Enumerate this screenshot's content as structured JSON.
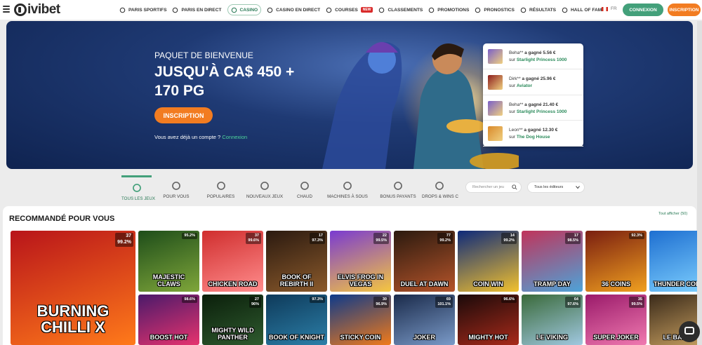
{
  "header": {
    "logo_text": "ivibet",
    "nav": [
      {
        "label": "PARIS SPORTIFS",
        "icon": "soccer-ball-icon"
      },
      {
        "label": "PARIS EN DIRECT",
        "icon": "live-icon"
      },
      {
        "label": "CASINO",
        "icon": "casino-chip-icon",
        "active": true
      },
      {
        "label": "CASINO EN DIRECT",
        "icon": "live-casino-icon"
      },
      {
        "label": "COURSES",
        "icon": "horse-icon",
        "badge": "NEW"
      },
      {
        "label": "CLASSEMENTS",
        "icon": "ranking-icon"
      },
      {
        "label": "PROMOTIONS",
        "icon": "gift-icon"
      },
      {
        "label": "PRONOSTICS",
        "icon": "prediction-icon"
      },
      {
        "label": "RÉSULTATS",
        "icon": "results-icon"
      },
      {
        "label": "HALL OF FAME",
        "icon": "crown-icon"
      }
    ],
    "lang": "FR",
    "login_label": "CONNEXION",
    "signup_label": "INSCRIPTION"
  },
  "hero": {
    "subtitle": "PAQUET DE BIENVENUE",
    "title": "JUSQU'À CA$ 450 + 170 PG",
    "cta": "INSCRIPTION",
    "login_prompt": "Vous avez déjà un compte ?",
    "login_link": "Connexion"
  },
  "winners": [
    {
      "user": "Beha**",
      "amount": "a gagné 5.56 €",
      "on": "sur",
      "game": "Starlight Princess 1000",
      "color": "#7a5fc8"
    },
    {
      "user": "Dirk**",
      "amount": "a gagné 25.96 €",
      "on": "sur",
      "game": "Aviator",
      "color": "#8c1d1d"
    },
    {
      "user": "Beha**",
      "amount": "a gagné 21.40 €",
      "on": "sur",
      "game": "Starlight Princess 1000",
      "color": "#7a5fc8"
    },
    {
      "user": "Leon**",
      "amount": "a gagné 12.30 €",
      "on": "sur",
      "game": "The Dog House",
      "color": "#d98a2b"
    }
  ],
  "categories": [
    {
      "label": "TOUS LES JEUX",
      "icon": "all-games-icon",
      "active": true
    },
    {
      "label": "POUR VOUS",
      "icon": "for-you-icon"
    },
    {
      "label": "POPULAIRES",
      "icon": "popular-crown-icon"
    },
    {
      "label": "NOUVEAUX JEUX",
      "icon": "star-icon"
    },
    {
      "label": "CHAUD",
      "icon": "hot-icon"
    },
    {
      "label": "MACHINES À SOUS",
      "icon": "slot-machine-icon"
    },
    {
      "label": "BONUS PAYANTS",
      "icon": "bonus-buy-icon"
    },
    {
      "label": "DROPS & WINS C",
      "icon": "drops-wins-icon"
    }
  ],
  "search": {
    "placeholder": "Rechercher un jeu"
  },
  "providers": {
    "label": "Tous les éditeurs"
  },
  "games_section": {
    "title": "RECOMMANDÉ POUR VOUS",
    "see_all": "Tout afficher (50)"
  },
  "games": [
    {
      "name": "BURNING CHILLI X",
      "stat1": "37",
      "stat2": "99.2%",
      "color1": "#b8141a",
      "color2": "#ff7a1a",
      "big": true
    },
    {
      "name": "MAJESTIC CLAWS",
      "stat1": "",
      "stat2": "95.2%",
      "color1": "#1e4d1a",
      "color2": "#7fa63a"
    },
    {
      "name": "CHICKEN ROAD",
      "stat1": "37",
      "stat2": "99.6%",
      "color1": "#d02e2e",
      "color2": "#ff8c8c"
    },
    {
      "name": "BOOK OF REBIRTH II",
      "stat1": "17",
      "stat2": "97.3%",
      "color1": "#2b1a10",
      "color2": "#8b5a2b"
    },
    {
      "name": "ELVIS FROG IN VEGAS",
      "stat1": "22",
      "stat2": "99.5%",
      "color1": "#7a3bd1",
      "color2": "#f5c640"
    },
    {
      "name": "DUEL AT DAWN",
      "stat1": "77",
      "stat2": "99.2%",
      "color1": "#2b1a0f",
      "color2": "#b5542a"
    },
    {
      "name": "COIN WIN",
      "stat1": "14",
      "stat2": "99.2%",
      "color1": "#0e2a7a",
      "color2": "#f2c12e"
    },
    {
      "name": "TRAMP DAY",
      "stat1": "17",
      "stat2": "98.5%",
      "color1": "#c0345b",
      "color2": "#4da3d8"
    },
    {
      "name": "36 COINS",
      "stat1": "",
      "stat2": "92.3%",
      "color1": "#7a1e10",
      "color2": "#f0a020"
    },
    {
      "name": "THUNDER COINS",
      "stat1": "",
      "stat2": "",
      "color1": "#1e6fd1",
      "color2": "#7fd1ff"
    },
    {
      "name": "BOOST HOT",
      "stat1": "",
      "stat2": "98.6%",
      "color1": "#4a1a6a",
      "color2": "#e6336e"
    },
    {
      "name": "MIGHTY WILD PANTHER",
      "stat1": "27",
      "stat2": "96%",
      "color1": "#0b1f0b",
      "color2": "#2e5a2e"
    },
    {
      "name": "BOOK OF KNIGHT",
      "stat1": "",
      "stat2": "97.3%",
      "color1": "#0e3a5a",
      "color2": "#2c7fa8"
    },
    {
      "name": "STICKY COIN",
      "stat1": "30",
      "stat2": "96.9%",
      "color1": "#0e3a8a",
      "color2": "#f07a1a"
    },
    {
      "name": "JOKER",
      "stat1": "69",
      "stat2": "101.1%",
      "color1": "#1a2a4a",
      "color2": "#7a9ac8"
    },
    {
      "name": "MIGHTY HOT",
      "stat1": "",
      "stat2": "96.6%",
      "color1": "#1a0a0a",
      "color2": "#a82a1a"
    },
    {
      "name": "LE VIKING",
      "stat1": "64",
      "stat2": "97.6%",
      "color1": "#3a6a3a",
      "color2": "#a0c8e0"
    },
    {
      "name": "SUPER JOKER",
      "stat1": "35",
      "stat2": "99.5%",
      "color1": "#9a1a6a",
      "color2": "#f07ab0"
    },
    {
      "name": "LE BANDIT",
      "stat1": "",
      "stat2": "",
      "color1": "#3a2a1a",
      "color2": "#c8a060"
    }
  ]
}
